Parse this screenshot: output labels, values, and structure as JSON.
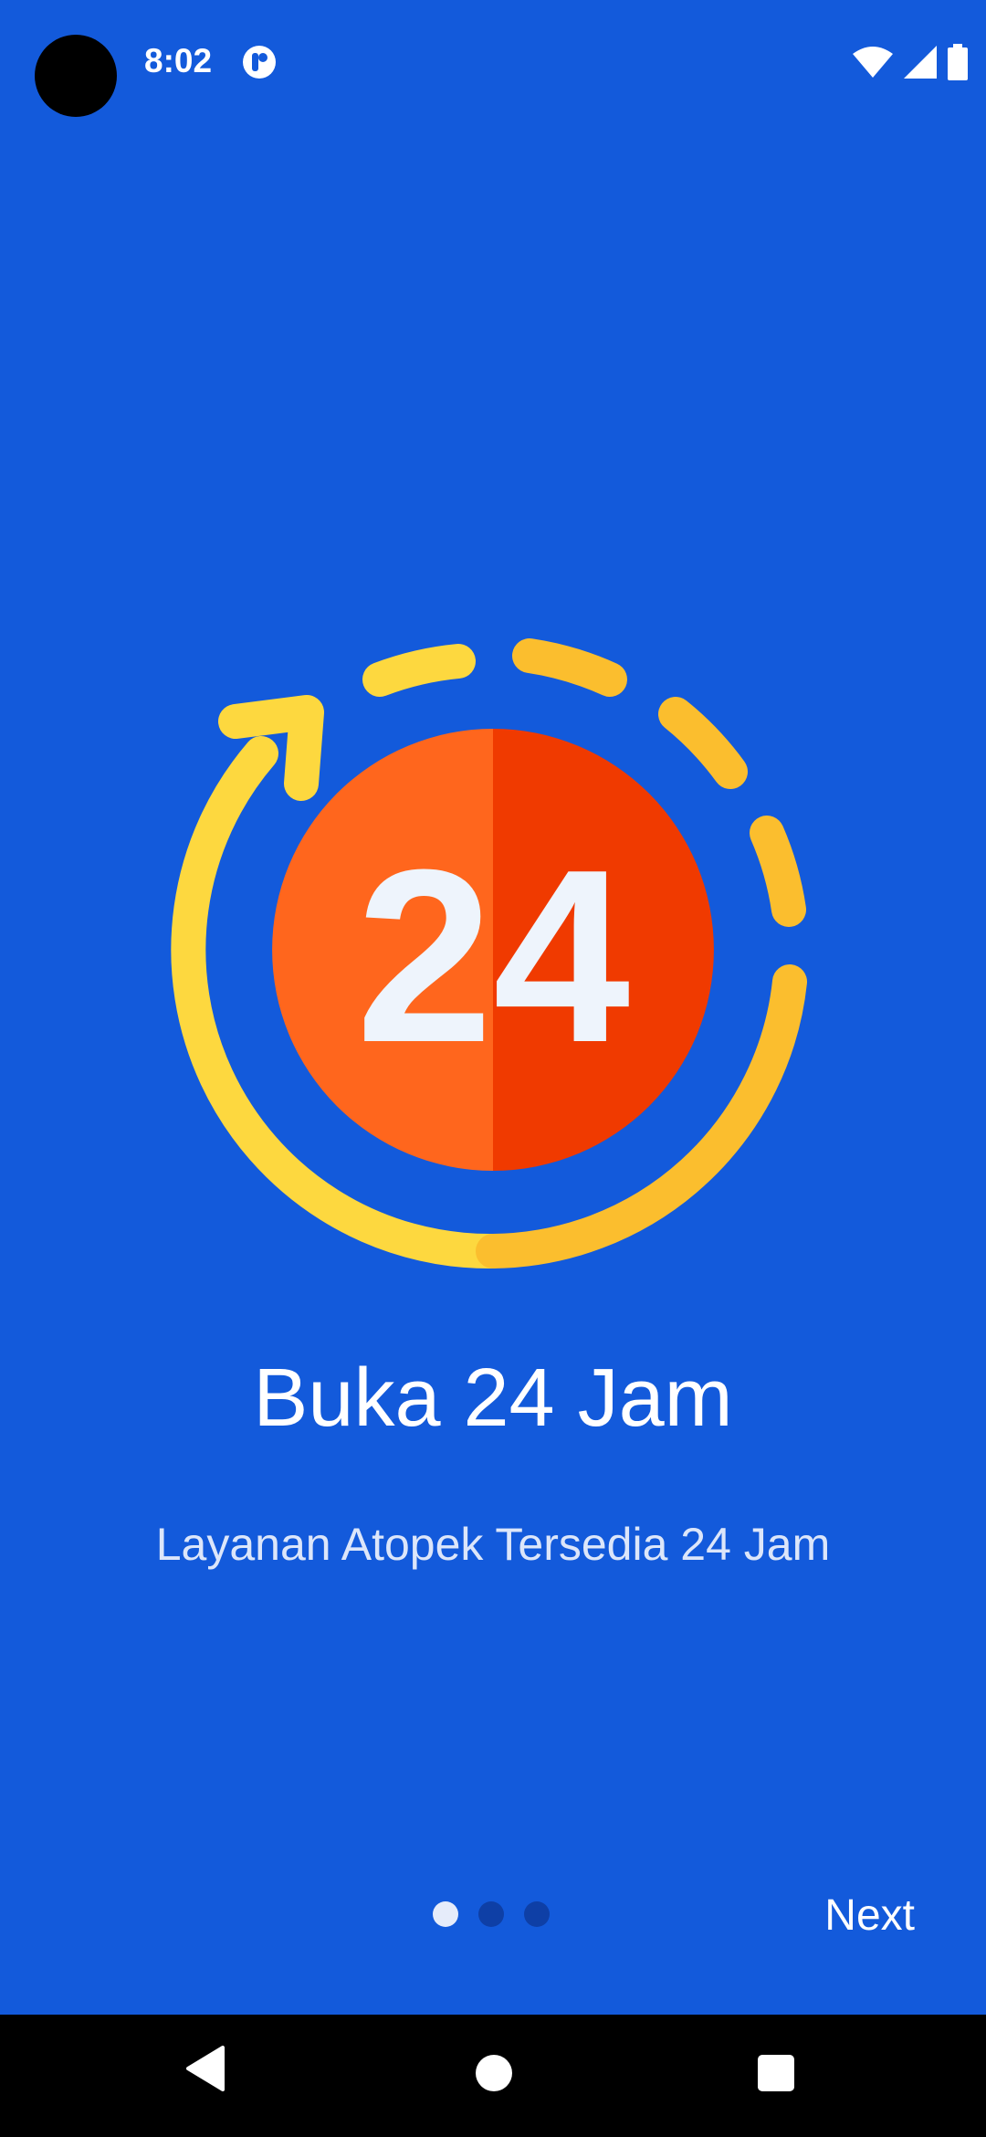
{
  "status_bar": {
    "time": "8:02",
    "icons": [
      "app-notification-icon",
      "wifi-icon",
      "signal-icon",
      "battery-icon"
    ]
  },
  "onboarding": {
    "illustration_icon": "24-hours-clock-icon",
    "illustration_text": "24",
    "title": "Buka 24 Jam",
    "subtitle": "Layanan Atopek Tersedia 24 Jam",
    "page_indicator": {
      "total": 3,
      "active": 1
    },
    "next_label": "Next"
  },
  "navigation_bar": {
    "icons": [
      "back-icon",
      "home-icon",
      "recent-apps-icon"
    ]
  },
  "colors": {
    "background": "#135ADB",
    "ring_yellow": "#FDD83F",
    "ring_amber": "#FBBE2E",
    "circle_left": "#FF661D",
    "circle_right": "#F03A00",
    "number_fill": "#EEF4FC"
  }
}
